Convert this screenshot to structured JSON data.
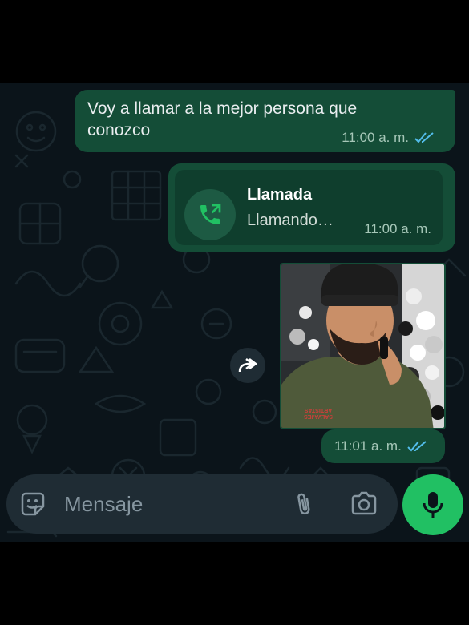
{
  "messages": [
    {
      "type": "text",
      "text": "Voy a llamar a la mejor persona que conozco",
      "time": "11:00 a. m.",
      "status": "read"
    },
    {
      "type": "call",
      "title": "Llamada",
      "subtitle": "Llamando…",
      "time": "11:00 a. m.",
      "icon": "outgoing-call-icon"
    },
    {
      "type": "photo",
      "time": "11:01 a. m.",
      "status": "read",
      "shirt_text": "ARTISTAS SALVAJES"
    }
  ],
  "composer": {
    "placeholder": "Mensaje",
    "icons": [
      "sticker-icon",
      "attach-icon",
      "camera-icon"
    ]
  },
  "mic_button": {
    "icon": "microphone-icon"
  },
  "forward_button": {
    "icon": "forward-icon"
  },
  "colors": {
    "chat_background": "#0b141a",
    "outgoing_bubble": "#144d37",
    "composer": "#1f2c34",
    "accent_green": "#21c063",
    "read_ticks": "#53bdeb"
  }
}
